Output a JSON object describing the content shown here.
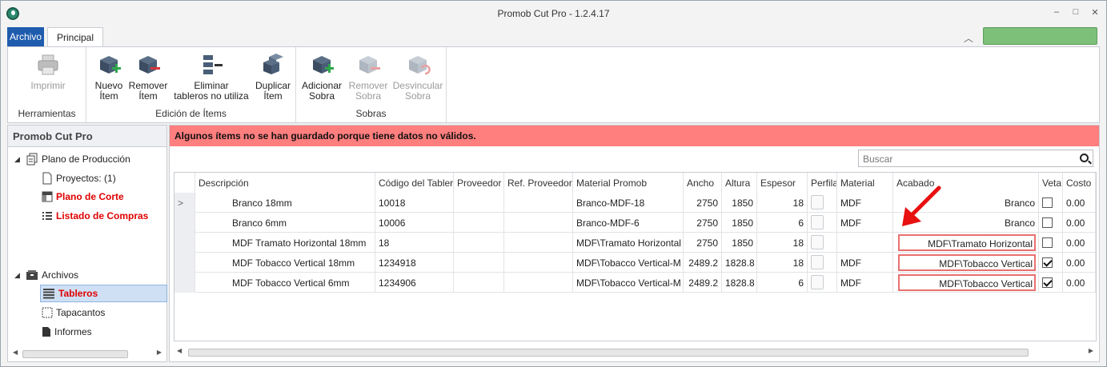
{
  "window": {
    "title": "Promob Cut Pro - 1.2.4.17",
    "controls": [
      "–",
      "□",
      "✕"
    ]
  },
  "ribbon_tabs": {
    "archivo": "Archivo",
    "principal": "Principal"
  },
  "ribbon": {
    "groups": [
      {
        "label": "Herramientas",
        "buttons": [
          {
            "line1": "Imprimir",
            "line2": ""
          }
        ]
      },
      {
        "label": "Edición de Ítems",
        "buttons": [
          {
            "line1": "Nuevo",
            "line2": "Ítem"
          },
          {
            "line1": "Remover",
            "line2": "Ítem"
          },
          {
            "line1": "Eliminar",
            "line2": "tableros no utiliza"
          },
          {
            "line1": "Duplicar",
            "line2": "Ítem"
          }
        ]
      },
      {
        "label": "Sobras",
        "buttons": [
          {
            "line1": "Adicionar",
            "line2": "Sobra"
          },
          {
            "line1": "Remover",
            "line2": "Sobra"
          },
          {
            "line1": "Desvincular",
            "line2": "Sobra"
          }
        ]
      }
    ]
  },
  "left_panel": {
    "title": "Promob Cut Pro",
    "tree": {
      "plano_produccion": "Plano de Producción",
      "proyectos": "Proyectos: (1)",
      "plano_corte": "Plano de Corte",
      "listado_compras": "Listado de Compras",
      "archivos": "Archivos",
      "tableros": "Tableros",
      "tapacantos": "Tapacantos",
      "informes": "Informes"
    }
  },
  "main": {
    "error_message": "Algunos ítems no se han guardado porque tiene datos no válidos.",
    "search": {
      "placeholder": "Buscar"
    },
    "columns": [
      "Descripción",
      "Código del Tablero",
      "Proveedor",
      "Ref. Proveedor",
      "Material Promob",
      "Ancho",
      "Altura",
      "Espesor",
      "Perfilado",
      "Material",
      "Acabado",
      "Veta",
      "Costo"
    ],
    "rows": [
      {
        "descripcion": "Branco 18mm",
        "codigo": "10018",
        "proveedor": "",
        "ref": "",
        "material_promob": "Branco-MDF-18",
        "ancho": "2750",
        "altura": "1850",
        "espesor": "18",
        "material": "MDF",
        "acabado": "Branco",
        "acabado_invalid": false,
        "veta": false,
        "costo": "0.00",
        "current": true
      },
      {
        "descripcion": "Branco 6mm",
        "codigo": "10006",
        "proveedor": "",
        "ref": "",
        "material_promob": "Branco-MDF-6",
        "ancho": "2750",
        "altura": "1850",
        "espesor": "6",
        "material": "MDF",
        "acabado": "Branco",
        "acabado_invalid": false,
        "veta": false,
        "costo": "0.00",
        "current": false
      },
      {
        "descripcion": "MDF Tramato Horizontal 18mm",
        "codigo": "18",
        "proveedor": "",
        "ref": "",
        "material_promob": "MDF\\Tramato Horizontal",
        "ancho": "2750",
        "altura": "1850",
        "espesor": "18",
        "material": "",
        "acabado": "MDF\\Tramato Horizontal",
        "acabado_invalid": true,
        "veta": false,
        "costo": "0.00",
        "current": false
      },
      {
        "descripcion": "MDF Tobacco Vertical 18mm",
        "codigo": "1234918",
        "proveedor": "",
        "ref": "",
        "material_promob": "MDF\\Tobacco Vertical-M",
        "ancho": "2489.2",
        "altura": "1828.8",
        "espesor": "18",
        "material": "MDF",
        "acabado": "MDF\\Tobacco Vertical",
        "acabado_invalid": true,
        "veta": true,
        "costo": "0.00",
        "current": false
      },
      {
        "descripcion": "MDF Tobacco Vertical 6mm",
        "codigo": "1234906",
        "proveedor": "",
        "ref": "",
        "material_promob": "MDF\\Tobacco Vertical-M",
        "ancho": "2489.2",
        "altura": "1828.8",
        "espesor": "6",
        "material": "MDF",
        "acabado": "MDF\\Tobacco Vertical",
        "acabado_invalid": true,
        "veta": true,
        "costo": "0.00",
        "current": false
      }
    ]
  },
  "colors": {
    "accent": "#1f5cae",
    "error_banner": "#ff7e7e",
    "invalid_border": "#e87070",
    "red_text": "#e00000",
    "green_bar": "#7cc07a"
  }
}
